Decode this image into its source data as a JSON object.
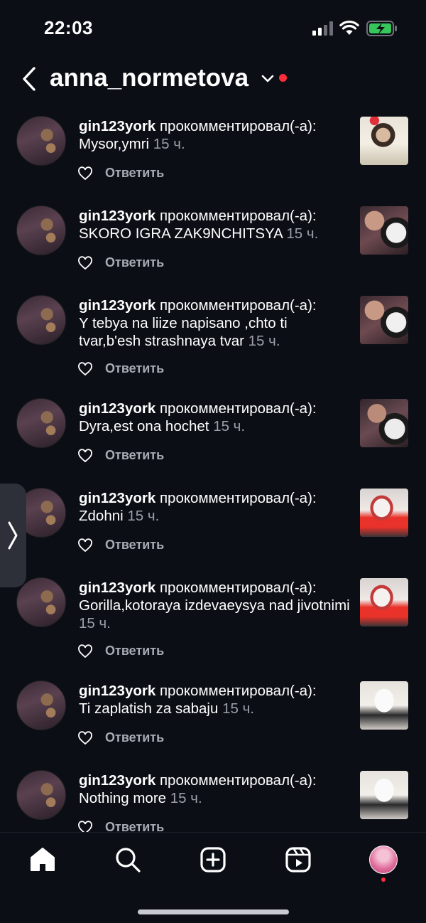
{
  "status_bar": {
    "time": "22:03"
  },
  "header": {
    "username": "anna_normetova",
    "notification_color": "#ff2d3a"
  },
  "comment_verb": "прокомментировал(-а):",
  "reply_label": "Ответить",
  "comments": [
    {
      "user": "gin123york",
      "text": "Mysor,ymri",
      "time": "15 ч.",
      "thumb": "selfie"
    },
    {
      "user": "gin123york",
      "text": "SKORO IGRA ZAK9NCHITSYA",
      "time": "15 ч.",
      "thumb": "cat-photo"
    },
    {
      "user": "gin123york",
      "text": "Y tebya na liize  napisano ,chto ti tvar,b'esh strashnaya tvar ",
      "time": "15 ч.",
      "thumb": "cat-photo"
    },
    {
      "user": "gin123york",
      "text": "Dyra,est ona hochet",
      "time": "15 ч.",
      "thumb": "cat-photo"
    },
    {
      "user": "gin123york",
      "text": "Zdohni",
      "time": "15 ч.",
      "thumb": "flowers-red-skirt"
    },
    {
      "user": "gin123york",
      "text": "Gorilla,kotoraya izdevaeysya nad jivotnimi",
      "time": "15 ч.",
      "thumb": "flowers-red-skirt"
    },
    {
      "user": "gin123york",
      "text": "Ti zaplatish za sabaju",
      "time": "15 ч.",
      "thumb": "white-outfit"
    },
    {
      "user": "gin123york",
      "text": "Nothing more",
      "time": "15 ч.",
      "thumb": "white-outfit"
    }
  ],
  "tabs": [
    "home-icon",
    "search-icon",
    "create-icon",
    "reels-icon",
    "profile-avatar"
  ],
  "colors": {
    "background": "#0c0e16",
    "muted": "#9c9fa8",
    "accent_red": "#ff2d3a"
  }
}
